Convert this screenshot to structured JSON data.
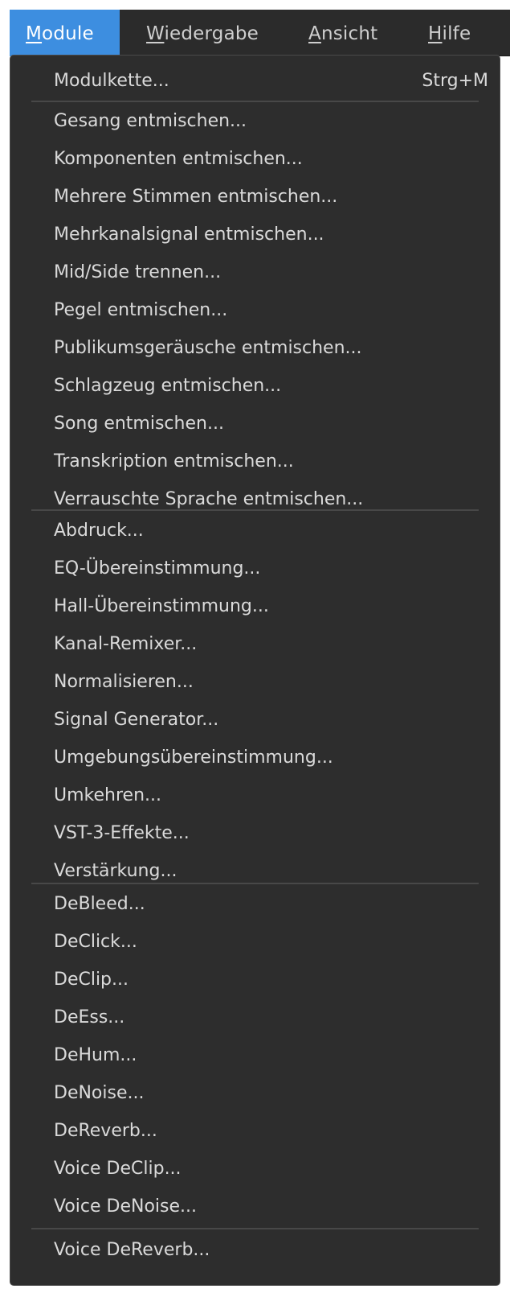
{
  "menubar": {
    "items": [
      {
        "mnemonic": "M",
        "rest": "odule",
        "active": true
      },
      {
        "mnemonic": "W",
        "rest": "iedergabe",
        "active": false
      },
      {
        "mnemonic": "A",
        "rest": "nsicht",
        "active": false
      },
      {
        "mnemonic": "H",
        "rest": "ilfe",
        "active": false
      }
    ]
  },
  "colors": {
    "accent": "#3d8ee0",
    "menu_bg": "#2d2d2d",
    "text": "#dadada"
  },
  "dropdown": {
    "items": [
      {
        "label": "Modulkette...",
        "shortcut": "Strg+M"
      },
      {
        "label": "Gesang entmischen..."
      },
      {
        "label": "Komponenten entmischen..."
      },
      {
        "label": "Mehrere Stimmen entmischen..."
      },
      {
        "label": "Mehrkanalsignal entmischen..."
      },
      {
        "label": "Mid/Side trennen..."
      },
      {
        "label": "Pegel entmischen..."
      },
      {
        "label": "Publikumsgeräusche entmischen..."
      },
      {
        "label": "Schlagzeug entmischen..."
      },
      {
        "label": "Song entmischen..."
      },
      {
        "label": "Transkription entmischen..."
      },
      {
        "label": "Verrauschte Sprache entmischen..."
      },
      {
        "label": "Abdruck..."
      },
      {
        "label": "EQ-Übereinstimmung..."
      },
      {
        "label": "Hall-Übereinstimmung..."
      },
      {
        "label": "Kanal-Remixer..."
      },
      {
        "label": "Normalisieren..."
      },
      {
        "label": "Signal Generator..."
      },
      {
        "label": "Umgebungsübereinstimmung..."
      },
      {
        "label": "Umkehren..."
      },
      {
        "label": "VST-3-Effekte..."
      },
      {
        "label": "Verstärkung..."
      },
      {
        "label": "DeBleed..."
      },
      {
        "label": "DeClick..."
      },
      {
        "label": "DeClip..."
      },
      {
        "label": "DeEss..."
      },
      {
        "label": "DeHum..."
      },
      {
        "label": "DeNoise..."
      },
      {
        "label": "DeReverb..."
      },
      {
        "label": "Voice DeClip..."
      },
      {
        "label": "Voice DeNoise..."
      },
      {
        "label": "Voice DeReverb..."
      }
    ]
  }
}
